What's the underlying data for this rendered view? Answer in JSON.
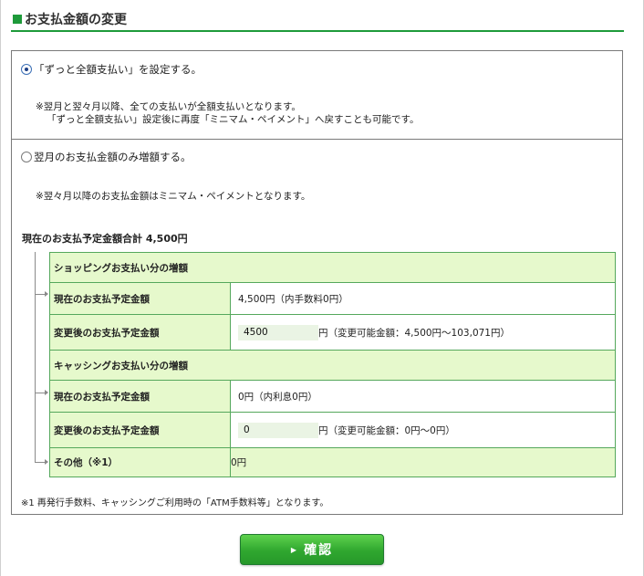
{
  "page": {
    "title": "お支払金額の変更"
  },
  "options": {
    "full_payment": {
      "label": "「ずっと全額支払い」を設定する。",
      "note_line1": "※翌月と翌々月以降、全ての支払いが全額支払いとなります。",
      "note_line2": "「ずっと全額支払い」設定後に再度「ミニマム・ペイメント」へ戻すことも可能です。",
      "selected": true
    },
    "increase_next": {
      "label": "翌月のお支払金額のみ増額する。",
      "note": "※翌々月以降のお支払金額はミニマム・ペイメントとなります。",
      "selected": false
    }
  },
  "total": {
    "label": "現在のお支払予定金額合計",
    "amount": "4,500円"
  },
  "shopping": {
    "header": "ショッピングお支払い分の増額",
    "current_label": "現在のお支払予定金額",
    "current_value": "4,500円（内手数料0円）",
    "changed_label": "変更後のお支払予定金額",
    "changed_input": "4500",
    "changed_suffix": "円（変更可能金額：4,500円〜103,071円）"
  },
  "cashing": {
    "header": "キャッシングお支払い分の増額",
    "current_label": "現在のお支払予定金額",
    "current_value": "0円（内利息0円）",
    "changed_label": "変更後のお支払予定金額",
    "changed_input": "0",
    "changed_suffix": "円（変更可能金額：0円〜0円）"
  },
  "other": {
    "label": "その他（※1）",
    "value": "0円"
  },
  "footnote": "※1 再発行手数料、キャッシングご利用時の「ATM手数料等」となります。",
  "confirm_button": {
    "label": "確認"
  },
  "colors": {
    "accent_green": "#1e9a3a",
    "table_label_bg": "#e6f9cc",
    "table_border": "#55a85c",
    "button_green": "#2fa72f"
  }
}
